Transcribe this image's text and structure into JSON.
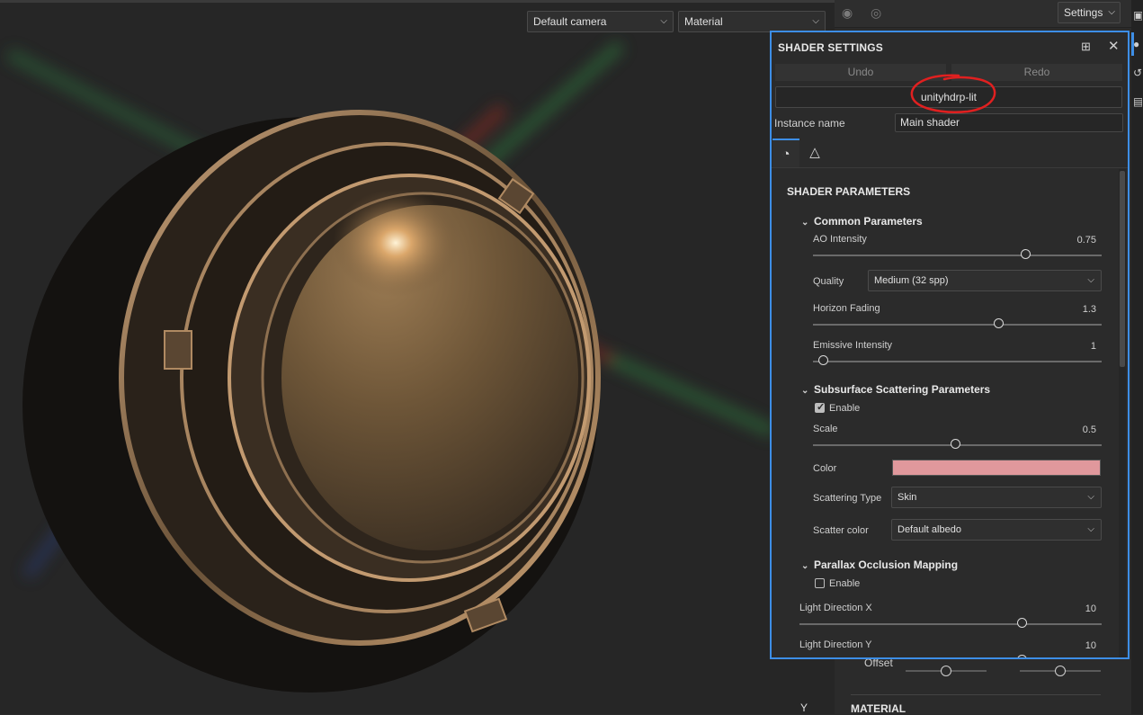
{
  "viewport": {
    "camera_select": "Default camera",
    "mode_select": "Material",
    "axis_label": "Y"
  },
  "side_panel": {
    "settings_label": "Settings",
    "offset_label": "Offset",
    "material_header": "MATERIAL"
  },
  "dialog": {
    "title": "SHADER SETTINGS",
    "undo_label": "Undo",
    "redo_label": "Redo",
    "shader_name": "unityhdrp-lit",
    "instance_label": "Instance name",
    "instance_value": "Main shader",
    "section_title": "SHADER PARAMETERS",
    "groups": {
      "common": {
        "title": "Common Parameters",
        "ao_label": "AO Intensity",
        "ao_value": "0.75",
        "quality_label": "Quality",
        "quality_value": "Medium (32 spp)",
        "horizon_label": "Horizon Fading",
        "horizon_value": "1.3",
        "emissive_label": "Emissive Intensity",
        "emissive_value": "1"
      },
      "sss": {
        "title": "Subsurface Scattering Parameters",
        "enable_label": "Enable",
        "enabled": true,
        "scale_label": "Scale",
        "scale_value": "0.5",
        "color_label": "Color",
        "color_hex": "#e0989c",
        "type_label": "Scattering Type",
        "type_value": "Skin",
        "scatter_color_label": "Scatter color",
        "scatter_color_value": "Default albedo"
      },
      "pom": {
        "title": "Parallax Occlusion Mapping",
        "enable_label": "Enable",
        "enabled": false,
        "light_x_label": "Light Direction X",
        "light_x_value": "10",
        "light_y_label": "Light Direction Y",
        "light_y_value": "10"
      }
    }
  },
  "colors": {
    "accent": "#3d8ee6",
    "annotation": "#e02020"
  }
}
